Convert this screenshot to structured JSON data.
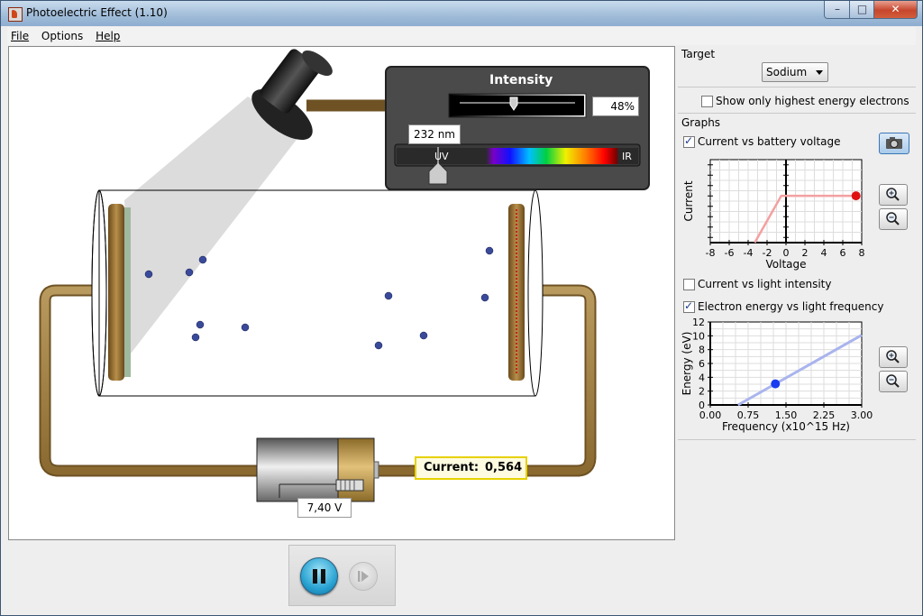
{
  "window": {
    "title": "Photoelectric Effect (1.10)",
    "min_glyph": "–",
    "max_glyph": "□",
    "close_glyph": "✕"
  },
  "menu": [
    "File",
    "Options",
    "Help"
  ],
  "sim": {
    "intensity_title": "Intensity",
    "intensity_value": "48%",
    "intensity_fraction": 0.48,
    "wavelength_value": "232 nm",
    "spectrum_left": "UV",
    "spectrum_right": "IR",
    "current_label": "Current:",
    "current_value": "0,564",
    "battery_value": "7,40 V"
  },
  "side": {
    "target_title": "Target",
    "target_selected": "Sodium",
    "show_highest_label": "Show only highest energy electrons",
    "show_highest_checked": false,
    "graphs_title": "Graphs",
    "graph1_label": "Current vs battery voltage",
    "graph1_checked": true,
    "graph2_label": "Current vs light intensity",
    "graph2_checked": false,
    "graph3_label": "Electron energy vs light frequency",
    "graph3_checked": true
  },
  "chart_data": [
    {
      "type": "line",
      "xlabel": "Voltage",
      "ylabel": "Current",
      "xlim": [
        -8,
        8
      ],
      "xticks": [
        "-8",
        "-6",
        "-4",
        "-2",
        "0",
        "2",
        "4",
        "6",
        "8"
      ],
      "grid": true,
      "series": [
        {
          "x": [
            -3.3,
            -0.5,
            7.4
          ],
          "y": [
            0.0,
            0.564,
            0.564
          ],
          "color": "#f4a0a0"
        }
      ],
      "marker": {
        "x": 7.4,
        "y": 0.564,
        "color": "#e01010"
      }
    },
    {
      "type": "line",
      "xlabel": "Frequency (x10^15 Hz)",
      "ylabel": "Energy (eV)",
      "xlim": [
        0,
        3
      ],
      "ylim": [
        0,
        12
      ],
      "xticks": [
        "0.00",
        "0.75",
        "1.50",
        "2.25",
        "3.00"
      ],
      "yticks": [
        "0",
        "2",
        "4",
        "6",
        "8",
        "10",
        "12"
      ],
      "grid": true,
      "series": [
        {
          "x": [
            0.55,
            3.0
          ],
          "y": [
            0.0,
            10.1
          ],
          "color": "#a9b4ee"
        }
      ],
      "marker": {
        "x": 1.29,
        "y": 3.05,
        "color": "#1a3cf0"
      }
    }
  ]
}
